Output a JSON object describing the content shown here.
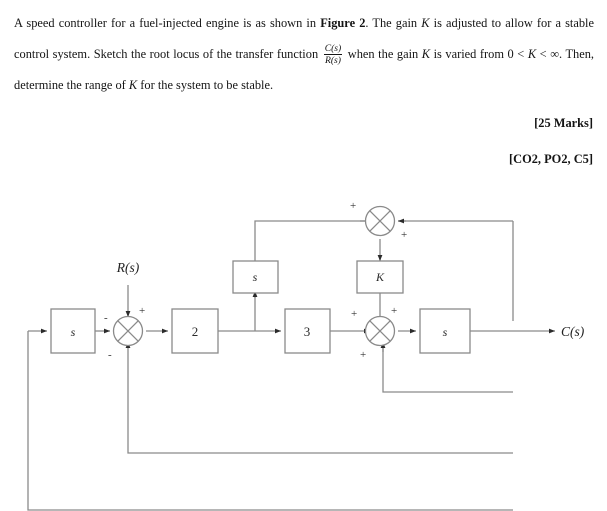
{
  "question": {
    "line1_a": "A speed controller for a fuel-injected engine is as shown in ",
    "figure_ref": "Figure 2",
    "line1_b": ". The gain ",
    "gain_symbol": "K",
    "line1_c": " is adjusted",
    "line2_a": "to allow for a stable control system. Sketch the root locus of the transfer function ",
    "fraction_num": "C(s)",
    "fraction_den": "R(s)",
    "line2_b": " when the",
    "line3_a": "gain ",
    "line3_b": " is varied from 0 < ",
    "line3_c": " < ∞. Then, determine the range of ",
    "line3_d": " for the system to be stable."
  },
  "marks": {
    "total": "[25 Marks]",
    "outcomes": "[CO2, PO2, C5]"
  },
  "diagram": {
    "input_label": "R(s)",
    "output_label": "C(s)",
    "blocks": [
      {
        "id": "feedback-s",
        "label": "s"
      },
      {
        "id": "gain-2",
        "label": "2"
      },
      {
        "id": "derivative-s",
        "label": "s"
      },
      {
        "id": "gain-3",
        "label": "3"
      },
      {
        "id": "gain-k",
        "label": "K"
      },
      {
        "id": "integrator-s",
        "label": "s"
      }
    ],
    "summing_junctions": [
      {
        "id": "sum-input",
        "signs": {
          "top": "+",
          "left": "-",
          "bottom": "-"
        }
      },
      {
        "id": "sum-top",
        "signs": {
          "left": "+",
          "right": "+"
        }
      },
      {
        "id": "sum-forward",
        "signs": {
          "top": "+",
          "left": "+",
          "bottom": "+"
        }
      }
    ],
    "colors": {
      "line": "#8a8a8a",
      "block_border": "#8a8a8a",
      "text": "#2b2b2b",
      "arrow": "#2b2b2b"
    }
  }
}
